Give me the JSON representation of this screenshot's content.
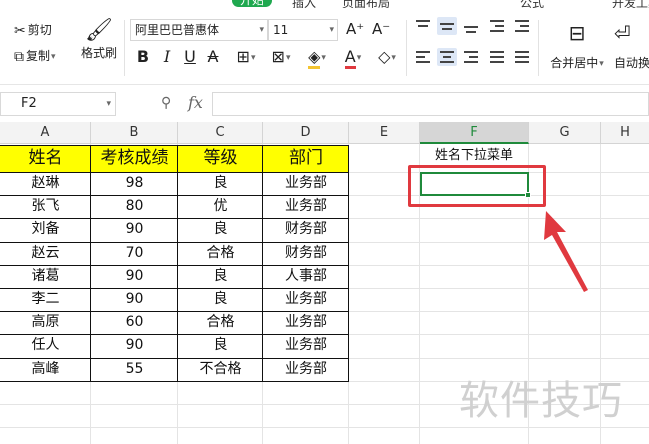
{
  "menu": {
    "tabs": [
      {
        "label": "开始",
        "active": true
      },
      {
        "label": "插入",
        "active": false
      },
      {
        "label": "页面布局",
        "active": false
      },
      {
        "label": "公式",
        "active": false
      },
      {
        "label": "开发工具",
        "active": false
      }
    ]
  },
  "ribbon": {
    "cut_label": "剪切",
    "copy_label": "复制",
    "format_painter_label": "格式刷",
    "font_name": "阿里巴巴普惠体",
    "font_size": "11",
    "grow_font": "A⁺",
    "shrink_font": "A⁻",
    "bold": "B",
    "italic": "I",
    "underline": "U",
    "merge_center_label": "合并居中",
    "wrap_label": "自动换行"
  },
  "formula_bar": {
    "name_box": "F2",
    "fx_label": "fx",
    "formula": ""
  },
  "columns": [
    "A",
    "B",
    "C",
    "D",
    "E",
    "F",
    "G",
    "H"
  ],
  "active_column": "F",
  "table": {
    "headers": [
      "姓名",
      "考核成绩",
      "等级",
      "部门"
    ],
    "rows": [
      [
        "赵琳",
        "98",
        "良",
        "业务部"
      ],
      [
        "张飞",
        "80",
        "优",
        "业务部"
      ],
      [
        "刘备",
        "90",
        "良",
        "财务部"
      ],
      [
        "赵云",
        "70",
        "合格",
        "财务部"
      ],
      [
        "诸葛",
        "90",
        "良",
        "人事部"
      ],
      [
        "李二",
        "90",
        "良",
        "业务部"
      ],
      [
        "高原",
        "60",
        "合格",
        "业务部"
      ],
      [
        "任人",
        "90",
        "良",
        "业务部"
      ],
      [
        "高峰",
        "55",
        "不合格",
        "业务部"
      ]
    ]
  },
  "dropdown_label_cell": "姓名下拉菜单",
  "watermark": "软件技巧",
  "colors": {
    "header_fill": "#ffff00",
    "selection": "#1f8a3b",
    "highlight_box": "#e0393f",
    "active_tab": "#1fa84f"
  }
}
